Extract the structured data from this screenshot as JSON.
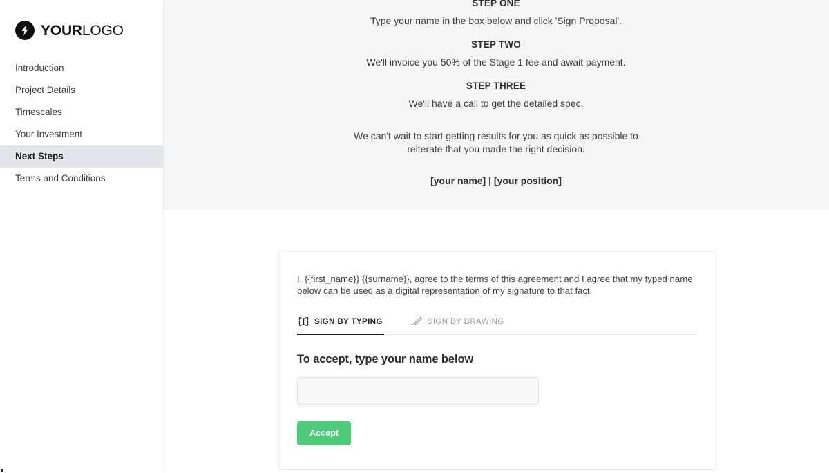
{
  "brand": {
    "logo_bold": "YOUR",
    "logo_light": "LOGO",
    "logo_icon": "lightning-bolt-icon",
    "logo_bg_color": "#0d0d0d"
  },
  "sidebar": {
    "items": [
      {
        "label": "Introduction",
        "active": false
      },
      {
        "label": "Project Details",
        "active": false
      },
      {
        "label": "Timescales",
        "active": false
      },
      {
        "label": "Your Investment",
        "active": false
      },
      {
        "label": "Next Steps",
        "active": true
      },
      {
        "label": "Terms and Conditions",
        "active": false
      }
    ],
    "active_bg_color": "#e3e6ea"
  },
  "steps_section": {
    "background_color": "#f6f6f6",
    "steps": [
      {
        "title": "STEP ONE",
        "body": "Type your name in the box below and click 'Sign Proposal'."
      },
      {
        "title": "STEP TWO",
        "body": "We'll invoice you 50% of the Stage 1 fee and await payment."
      },
      {
        "title": "STEP THREE",
        "body": "We'll have a call to get the detailed spec."
      }
    ],
    "closing_paragraph": "We can't wait to start getting results for you as quick as possible to reiterate that you made the right decision.",
    "signoff": "[your name] | [your position]"
  },
  "sign_card": {
    "agreement_text": "I, {{first_name}} {{surname}}, agree to the terms of this agreement and I agree that my typed name below can be used as a digital representation of my signature to that fact.",
    "tabs": [
      {
        "label": "SIGN BY TYPING",
        "icon": "text-cursor-box-icon",
        "active": true
      },
      {
        "label": "SIGN BY DRAWING",
        "icon": "pen-signature-icon",
        "active": false
      }
    ],
    "accept_heading": "To accept, type your name below",
    "name_input_value": "",
    "name_input_placeholder": "",
    "accept_button_label": "Accept",
    "accept_button_color": "#4ecb79"
  }
}
